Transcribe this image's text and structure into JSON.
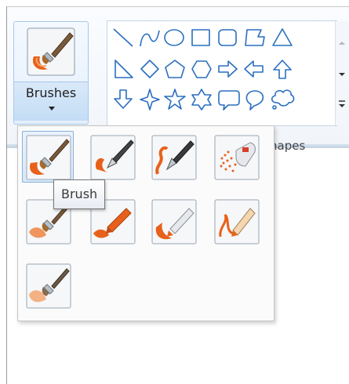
{
  "brushes_button": {
    "label": "Brushes",
    "icon": "brush-icon"
  },
  "shapes_group": {
    "label": "hapes",
    "shapes": [
      "line",
      "curve",
      "oval",
      "rectangle",
      "rounded-rectangle",
      "polygon",
      "triangle",
      "right-triangle",
      "diamond",
      "pentagon",
      "hexagon",
      "right-arrow",
      "left-arrow",
      "up-arrow",
      "down-arrow",
      "four-point-star",
      "five-point-star",
      "six-point-star",
      "rounded-callout",
      "oval-callout",
      "cloud-callout"
    ]
  },
  "brush_gallery": {
    "options": [
      {
        "name": "brush",
        "selected": true
      },
      {
        "name": "calligraphy-brush-1",
        "selected": false
      },
      {
        "name": "calligraphy-brush-2",
        "selected": false
      },
      {
        "name": "airbrush",
        "selected": false
      },
      {
        "name": "oil-brush",
        "selected": false
      },
      {
        "name": "crayon",
        "selected": false
      },
      {
        "name": "marker",
        "selected": false
      },
      {
        "name": "natural-pencil",
        "selected": false
      },
      {
        "name": "watercolor-brush",
        "selected": false
      }
    ]
  },
  "tooltip": {
    "text": "Brush"
  },
  "colors": {
    "accent_orange": "#e8611a",
    "selection_blue": "#86b0da",
    "shape_outline": "#2a6fc0"
  }
}
